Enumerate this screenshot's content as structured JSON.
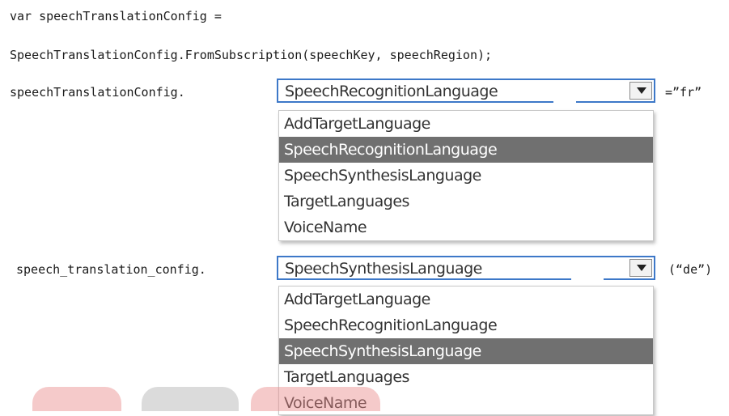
{
  "code": {
    "line1": "var speechTranslationConfig =",
    "line2": "SpeechTranslationConfig.FromSubscription(speechKey, speechRegion);",
    "line3": "speechTranslationConfig.",
    "suffix1": "=”fr”",
    "line4": "speech_translation_config.",
    "suffix2": "(“de”)"
  },
  "dropdown1": {
    "selected": "SpeechRecognitionLanguage",
    "options": [
      "AddTargetLanguage",
      "SpeechRecognitionLanguage",
      "SpeechSynthesisLanguage",
      "TargetLanguages",
      "VoiceName"
    ],
    "highlighted_index": 1
  },
  "dropdown2": {
    "selected": "SpeechSynthesisLanguage",
    "options": [
      "AddTargetLanguage",
      "SpeechRecognitionLanguage",
      "SpeechSynthesisLanguage",
      "TargetLanguages",
      "VoiceName"
    ],
    "highlighted_index": 2
  },
  "icons": {
    "dropdown_arrow": "chevron-down-icon"
  },
  "colors": {
    "select_border": "#3d78c8",
    "highlight_bg": "#707070",
    "watermark_red": "#e88a8a",
    "watermark_gray": "#b0b0b0"
  }
}
